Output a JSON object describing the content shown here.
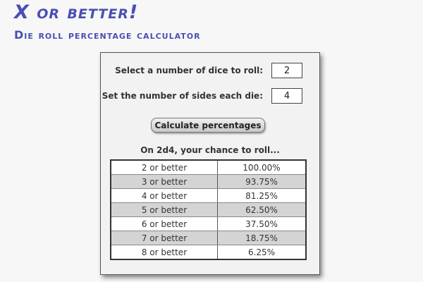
{
  "header": {
    "title": "X or better!",
    "subtitle": "Die roll percentage calculator"
  },
  "form": {
    "dice_count_label": "Select a number of dice to roll:",
    "dice_count_value": "2",
    "sides_label": "Set the number of sides each die:",
    "sides_value": "4",
    "calculate_label": "Calculate percentages"
  },
  "results": {
    "heading": "On 2d4, your chance to roll...",
    "rows": [
      {
        "label": "2 or better",
        "percent": "100.00%"
      },
      {
        "label": "3 or better",
        "percent": "93.75%"
      },
      {
        "label": "4 or better",
        "percent": "81.25%"
      },
      {
        "label": "5 or better",
        "percent": "62.50%"
      },
      {
        "label": "6 or better",
        "percent": "37.50%"
      },
      {
        "label": "7 or better",
        "percent": "18.75%"
      },
      {
        "label": "8 or better",
        "percent": "6.25%"
      }
    ]
  },
  "colors": {
    "title": "#4a4fb4",
    "row_alt": "#d4d4d4",
    "row_normal": "#ffffff"
  }
}
